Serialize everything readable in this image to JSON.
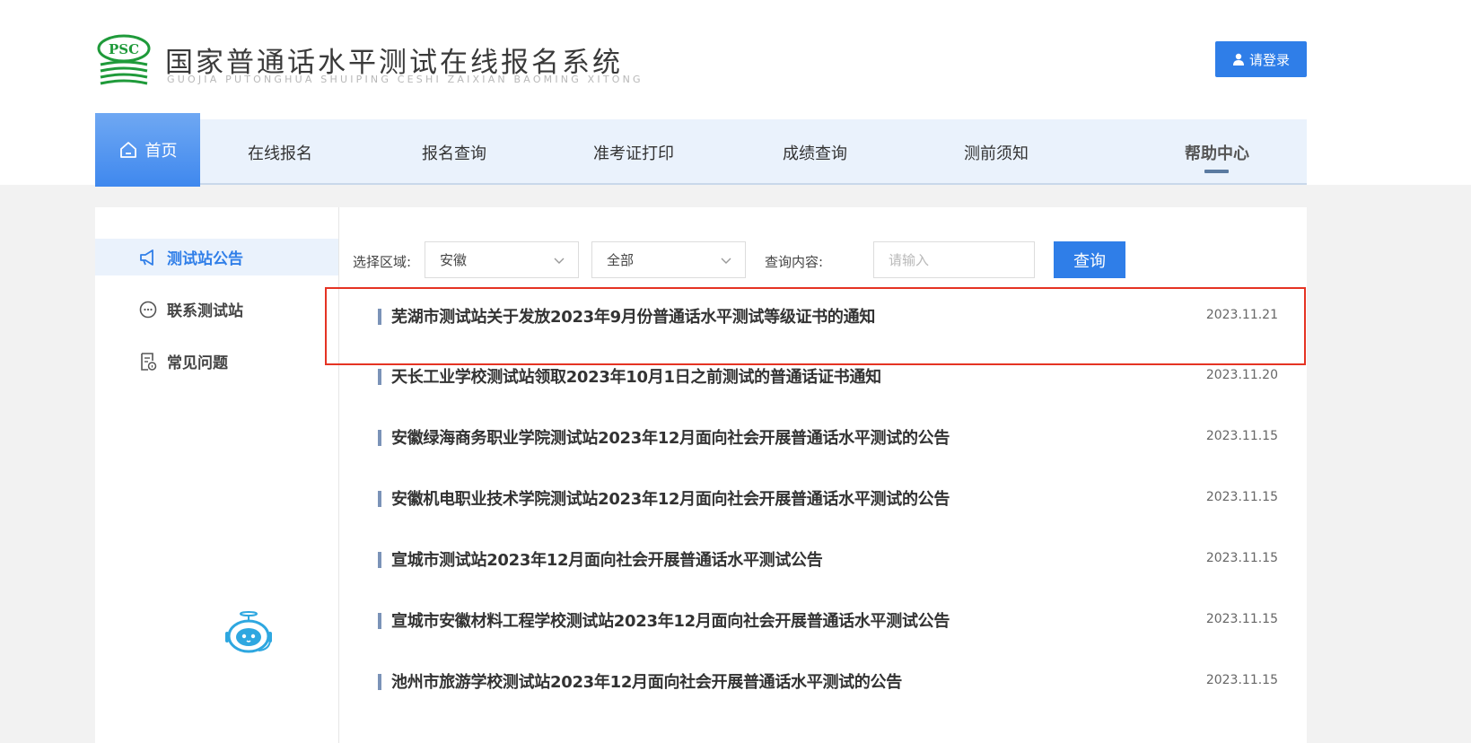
{
  "header": {
    "title": "国家普通话水平测试在线报名系统",
    "subtitle": "GUOJIA PUTONGHUA SHUIPING CESHI ZAIXIAN BAOMING XITONG",
    "logo_text": "PSC",
    "login_label": "请登录"
  },
  "nav": {
    "home": "首页",
    "items": [
      "在线报名",
      "报名查询",
      "准考证打印",
      "成绩查询",
      "测前须知",
      "帮助中心"
    ]
  },
  "sidebar": {
    "items": [
      "测试站公告",
      "联系测试站",
      "常见问题"
    ]
  },
  "filter": {
    "region_label": "选择区域:",
    "region_value": "安徽",
    "scope_value": "全部",
    "query_label": "查询内容:",
    "query_placeholder": "请输入",
    "query_button": "查询"
  },
  "news": [
    {
      "title": "芜湖市测试站关于发放2023年9月份普通话水平测试等级证书的通知",
      "date": "2023.11.21"
    },
    {
      "title": "天长工业学校测试站领取2023年10月1日之前测试的普通话证书通知",
      "date": "2023.11.20"
    },
    {
      "title": "安徽绿海商务职业学院测试站2023年12月面向社会开展普通话水平测试的公告",
      "date": "2023.11.15"
    },
    {
      "title": "安徽机电职业技术学院测试站2023年12月面向社会开展普通话水平测试的公告",
      "date": "2023.11.15"
    },
    {
      "title": "宣城市测试站2023年12月面向社会开展普通话水平测试公告",
      "date": "2023.11.15"
    },
    {
      "title": "宣城市安徽材料工程学校测试站2023年12月面向社会开展普通话水平测试公告",
      "date": "2023.11.15"
    },
    {
      "title": "池州市旅游学校测试站2023年12月面向社会开展普通话水平测试的公告",
      "date": "2023.11.15"
    }
  ],
  "colors": {
    "accent": "#2f7ee8",
    "nav_bg": "#eaf2fc",
    "highlight": "#e53323",
    "logo_green": "#1f9a3a"
  }
}
